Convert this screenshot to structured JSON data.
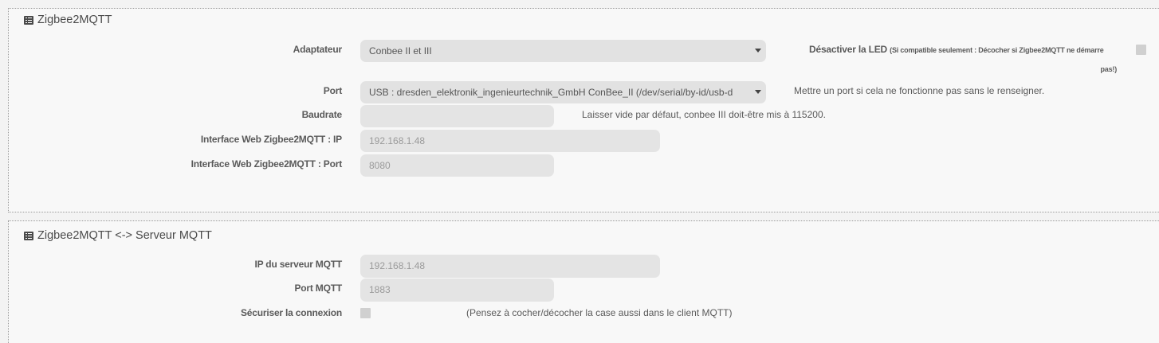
{
  "section_zigbee": {
    "title": "Zigbee2MQTT",
    "adapter_label": "Adaptateur",
    "adapter_value": "Conbee II et III",
    "led_label": "Désactiver la LED",
    "led_note_line1": "(Si compatible seulement : Décocher si Zigbee2MQTT ne démarre",
    "led_note_line2": "pas!)",
    "port_label": "Port",
    "port_value": "USB : dresden_elektronik_ingenieurtechnik_GmbH ConBee_II (/dev/serial/by-id/usb-d",
    "port_help": "Mettre un port si cela ne fonctionne pas sans le renseigner.",
    "baudrate_label": "Baudrate",
    "baudrate_value": "",
    "baudrate_help": "Laisser vide par défaut, conbee III doit-être mis à 115200.",
    "web_ip_label": "Interface Web Zigbee2MQTT : IP",
    "web_ip_value": "192.168.1.48",
    "web_port_label": "Interface Web Zigbee2MQTT : Port",
    "web_port_value": "8080"
  },
  "section_mqtt": {
    "title": "Zigbee2MQTT <-> Serveur MQTT",
    "ip_label": "IP du serveur MQTT",
    "ip_value": "192.168.1.48",
    "port_label": "Port MQTT",
    "port_value": "1883",
    "secure_label": "Sécuriser la connexion",
    "secure_help": "(Pensez à cocher/décocher la case aussi dans le client MQTT)"
  },
  "icons": {
    "legend_icon": "list-icon"
  }
}
